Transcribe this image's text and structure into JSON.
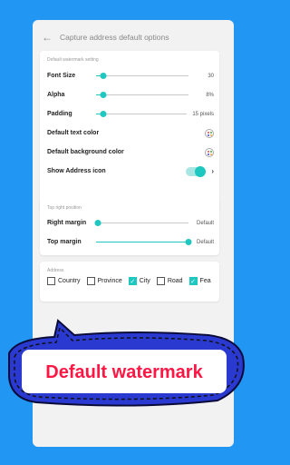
{
  "header": {
    "back_icon": "arrow-left-icon",
    "title": "Capture address default options"
  },
  "watermark_card": {
    "title": "Default watermark setting",
    "font_size": {
      "label": "Font Size",
      "value": "30",
      "level": 0.08
    },
    "alpha": {
      "label": "Alpha",
      "value": "8%",
      "level": 0.08
    },
    "padding": {
      "label": "Padding",
      "value": "15 pixels",
      "level": 0.08
    },
    "text_color": {
      "label": "Default text color",
      "icon": "palette-icon"
    },
    "bg_color": {
      "label": "Default background color",
      "icon": "palette-icon"
    },
    "show_icon": {
      "label": "Show Address icon",
      "enabled": true,
      "icon": "chevron-right-icon"
    }
  },
  "position_card": {
    "title": "Top right position",
    "right_margin": {
      "label": "Right margin",
      "value": "Default",
      "level": 0.02
    },
    "top_margin": {
      "label": "Top margin",
      "value": "Default",
      "level": 1.0
    }
  },
  "address_card": {
    "title": "Address",
    "items": [
      {
        "label": "Country",
        "checked": false
      },
      {
        "label": "Province",
        "checked": false
      },
      {
        "label": "City",
        "checked": true
      },
      {
        "label": "Road",
        "checked": false
      },
      {
        "label": "Fea",
        "checked": true
      }
    ]
  },
  "banner": {
    "text": "Default watermark"
  },
  "colors": {
    "background": "#2196f3",
    "accent": "#1ec8c0",
    "banner_blue": "#2a3ad0"
  }
}
